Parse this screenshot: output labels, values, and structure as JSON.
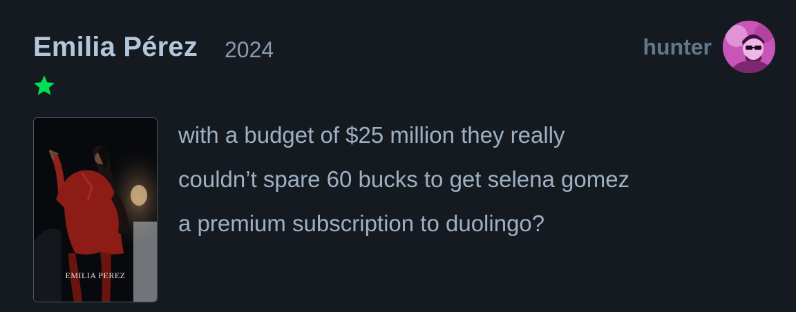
{
  "review": {
    "film_title": "Emilia Pérez",
    "film_year": "2024",
    "rating": {
      "stars": 1,
      "out_of": 5,
      "star_color": "#00e054"
    },
    "reviewer": {
      "username": "hunter"
    },
    "poster": {
      "caption": "EMILIA PEREZ"
    },
    "body_lines": [
      "with a budget of $25 million they really",
      "couldn’t spare 60 bucks to get selena gomez",
      "a premium subscription to duolingo?"
    ]
  },
  "colors": {
    "background": "#151a21",
    "title": "#b3c7dc",
    "year": "#8a9aab",
    "username": "#62788c",
    "body_text": "#9eb0c2",
    "accent_green": "#00e054"
  }
}
